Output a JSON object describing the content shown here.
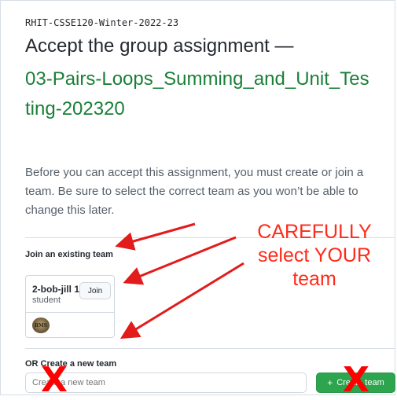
{
  "header": {
    "org": "RHIT-CSSE120-Winter-2022-23",
    "title": "Accept the group assignment —",
    "assignment_name": "03-Pairs-Loops_Summing_and_Unit_Testing-202320"
  },
  "description": "Before you can accept this assignment, you must create or join a team. Be sure to select the correct team as you won’t be able to change this later.",
  "join_section": {
    "label": "Join an existing team",
    "teams": [
      {
        "name": "2-bob-jill 1",
        "role": "student",
        "join_label": "Join",
        "avatar_text": "RMS"
      }
    ]
  },
  "create_section": {
    "label": "OR Create a new team",
    "input_placeholder": "Create a new team",
    "button_label": "Create team",
    "button_icon": "plus-icon"
  },
  "annotations": {
    "callout_lines": [
      "CAREFULLY",
      "select YOUR",
      "team"
    ],
    "x_mark": "X",
    "color": "#ff2a1a"
  },
  "colors": {
    "assignment_green": "#1a7f37",
    "button_green": "#2da44e"
  }
}
